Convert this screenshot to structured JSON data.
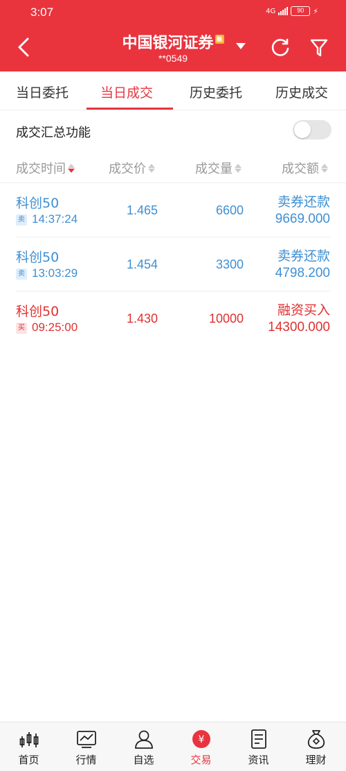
{
  "status_bar": {
    "time": "3:07",
    "network": "4G",
    "battery": "90"
  },
  "header": {
    "title": "中国银河证券",
    "badge": "融",
    "account": "**0549"
  },
  "tabs": [
    "当日委托",
    "当日成交",
    "历史委托",
    "历史成交"
  ],
  "active_tab": "当日成交",
  "summary": {
    "label": "成交汇总功能",
    "enabled": false
  },
  "columns": [
    "成交时间",
    "成交价",
    "成交量",
    "成交额"
  ],
  "trades": [
    {
      "name": "科创50",
      "side": "卖",
      "time": "14:37:24",
      "price": "1.465",
      "quantity": "6600",
      "type": "卖券还款",
      "amount": "9669.000"
    },
    {
      "name": "科创50",
      "side": "卖",
      "time": "13:03:29",
      "price": "1.454",
      "quantity": "3300",
      "type": "卖券还款",
      "amount": "4798.200"
    },
    {
      "name": "科创50",
      "side": "买",
      "time": "09:25:00",
      "price": "1.430",
      "quantity": "10000",
      "type": "融资买入",
      "amount": "14300.000"
    }
  ],
  "bottom_nav": [
    "首页",
    "行情",
    "自选",
    "交易",
    "资讯",
    "理财"
  ],
  "active_nav": "交易",
  "colors": {
    "brand_red": "#e9343e",
    "sell_blue": "#3f8fd2",
    "buy_red": "#e03030"
  }
}
